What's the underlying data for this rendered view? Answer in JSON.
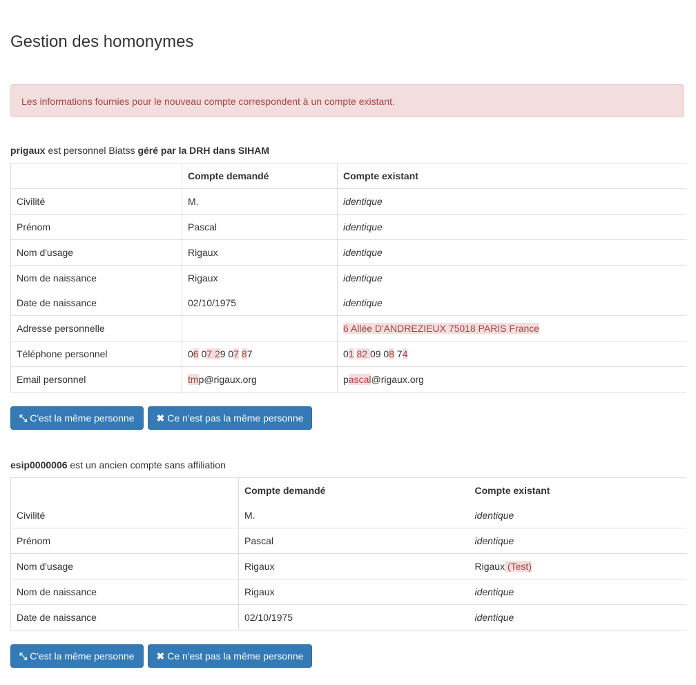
{
  "page": {
    "title": "Gestion des homonymes"
  },
  "alert": {
    "text": "Les informations fournies pour le nouveau compte correspondent à un compte existant."
  },
  "sections": [
    {
      "login": "prigaux",
      "text1": " est personnel Biatss ",
      "text2": "géré par la DRH dans SIHAM",
      "headers": {
        "requested": "Compte demandé",
        "existing": "Compte existant"
      },
      "rows": {
        "civilite": {
          "label": "Civilité",
          "requested": "M.",
          "existing": "identique"
        },
        "prenom": {
          "label": "Prénom",
          "requested": "Pascal",
          "existing": "identique"
        },
        "nom_usage": {
          "label": "Nom d'usage",
          "requested": "Rigaux",
          "existing": "identique"
        },
        "nom_naissance": {
          "label": "Nom de naissance",
          "requested": "Rigaux",
          "existing": "identique"
        },
        "date_naissance": {
          "label": "Date de naissance",
          "requested": "02/10/1975",
          "existing": "identique"
        },
        "adresse": {
          "label": "Adresse personnelle",
          "requested": "",
          "existing": "6 Allée D'ANDREZIEUX 75018 PARIS France"
        },
        "telephone": {
          "label": "Téléphone personnel",
          "requested": [
            "0",
            "6",
            " 0",
            "7 2",
            "9 0",
            "7",
            " ",
            "8",
            "7"
          ],
          "existing": [
            "0",
            "1",
            " ",
            "82 ",
            "09 0",
            "8",
            " 7",
            "4"
          ]
        },
        "email": {
          "label": "Email personnel",
          "requested": [
            "tm",
            "p@rigaux.org"
          ],
          "existing": [
            "p",
            "ascal",
            "@rigaux.org"
          ]
        }
      },
      "buttons": {
        "same": "C'est la même personne",
        "not_same": "Ce n'est pas la même personne"
      }
    },
    {
      "login": "esip0000006",
      "text1": " est un ancien compte sans affiliation",
      "headers": {
        "requested": "Compte demandé",
        "existing": "Compte existant"
      },
      "rows": {
        "civilite": {
          "label": "Civilité",
          "requested": "M.",
          "existing": "identique"
        },
        "prenom": {
          "label": "Prénom",
          "requested": "Pascal",
          "existing": "identique"
        },
        "nom_usage": {
          "label": "Nom d'usage",
          "requested": "Rigaux",
          "existing": [
            "Rigaux",
            " (Test)"
          ]
        },
        "nom_naissance": {
          "label": "Nom de naissance",
          "requested": "Rigaux",
          "existing": "identique"
        },
        "date_naissance": {
          "label": "Date de naissance",
          "requested": "02/10/1975",
          "existing": "identique"
        }
      },
      "buttons": {
        "same": "C'est la même personne",
        "not_same": "Ce n'est pas la même personne"
      }
    }
  ],
  "icons": {
    "same": "compress-icon",
    "not_same": "close-icon"
  },
  "colors": {
    "primary": "#337ab7",
    "danger_bg": "#f2dede",
    "danger_text": "#a94442"
  }
}
